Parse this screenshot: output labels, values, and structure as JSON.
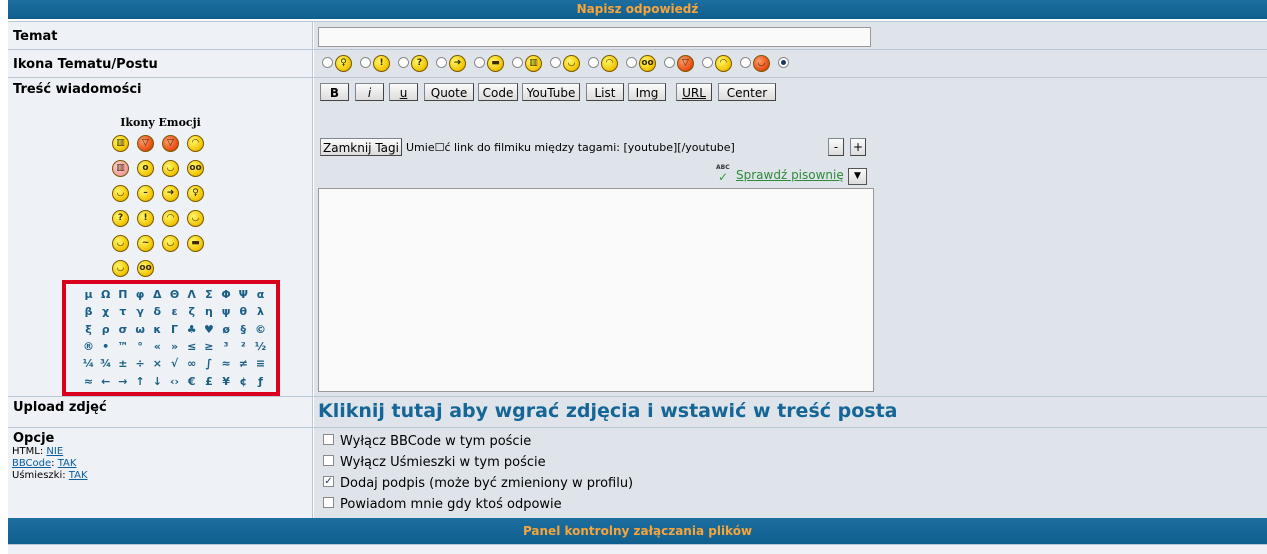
{
  "header": {
    "title": "Napisz odpowiedź"
  },
  "footer": {
    "title": "Panel kontrolny załączania plików"
  },
  "temat": {
    "label": "Temat",
    "value": ""
  },
  "ikona": {
    "label": "Ikona Tematu/Postu",
    "icons": [
      "bulb-smiley-icon",
      "exclaim-smiley-icon",
      "question-smiley-icon",
      "arrow-smiley-icon",
      "cool-smiley-icon",
      "grin-smiley-icon",
      "laugh-smiley-icon",
      "sad-smiley-icon",
      "eek-smiley-icon",
      "evil-smiley-icon",
      "frown-smiley-icon",
      "tongue-smiley-icon"
    ]
  },
  "tresc": {
    "label": "Treść wiadomości",
    "emoticons_title": "Ikony Emocji",
    "buttons": {
      "b": "B",
      "i": "i",
      "u": "u",
      "quote": "Quote",
      "code": "Code",
      "youtube": "YouTube",
      "list": "List",
      "img": "Img",
      "url": "URL",
      "center": "Center"
    },
    "close_tags": "Zamknij Tagi",
    "hint": "Umie☐ć link do filmiku między tagami: [youtube][/youtube]",
    "minus": "-",
    "plus": "+",
    "abc": "ABC",
    "spellcheck": "Sprawdź pisownię",
    "message": "",
    "chars": [
      [
        "μ",
        "Ω",
        "Π",
        "φ",
        "Δ",
        "Θ",
        "Λ",
        "Σ",
        "Φ",
        "Ψ",
        "α"
      ],
      [
        "β",
        "χ",
        "τ",
        "γ",
        "δ",
        "ε",
        "ζ",
        "η",
        "ψ",
        "θ",
        "λ"
      ],
      [
        "ξ",
        "ρ",
        "σ",
        "ω",
        "κ",
        "Γ",
        "♣",
        "♥",
        "ø",
        "§",
        "©"
      ],
      [
        "®",
        "•",
        "™",
        "°",
        "«",
        "»",
        "≤",
        "≥",
        "³",
        "²",
        "½"
      ],
      [
        "¼",
        "¾",
        "±",
        "÷",
        "×",
        "√",
        "∞",
        "∫",
        "≈",
        "≠",
        "≡"
      ],
      [
        "≈",
        "←",
        "→",
        "↑",
        "↓",
        "‹›",
        "€",
        "£",
        "¥",
        "¢",
        "ƒ"
      ]
    ]
  },
  "upload": {
    "label": "Upload zdjęć",
    "link": "Kliknij tutaj aby wgrać zdjęcia i wstawić w treść posta"
  },
  "opcje": {
    "label": "Opcje",
    "html_label": "HTML:",
    "html_value": "NIE",
    "bbcode_label": "BBCode",
    "bbcode_value": "TAK",
    "smilies_label": "Uśmieszki:",
    "smilies_value": "TAK",
    "options": [
      {
        "label": "Wyłącz BBCode w tym poście",
        "checked": false
      },
      {
        "label": "Wyłącz Uśmieszki w tym poście",
        "checked": false
      },
      {
        "label": "Dodaj podpis (może być zmieniony w profilu)",
        "checked": true
      },
      {
        "label": "Powiadom mnie gdy ktoś odpowie",
        "checked": false
      }
    ]
  }
}
